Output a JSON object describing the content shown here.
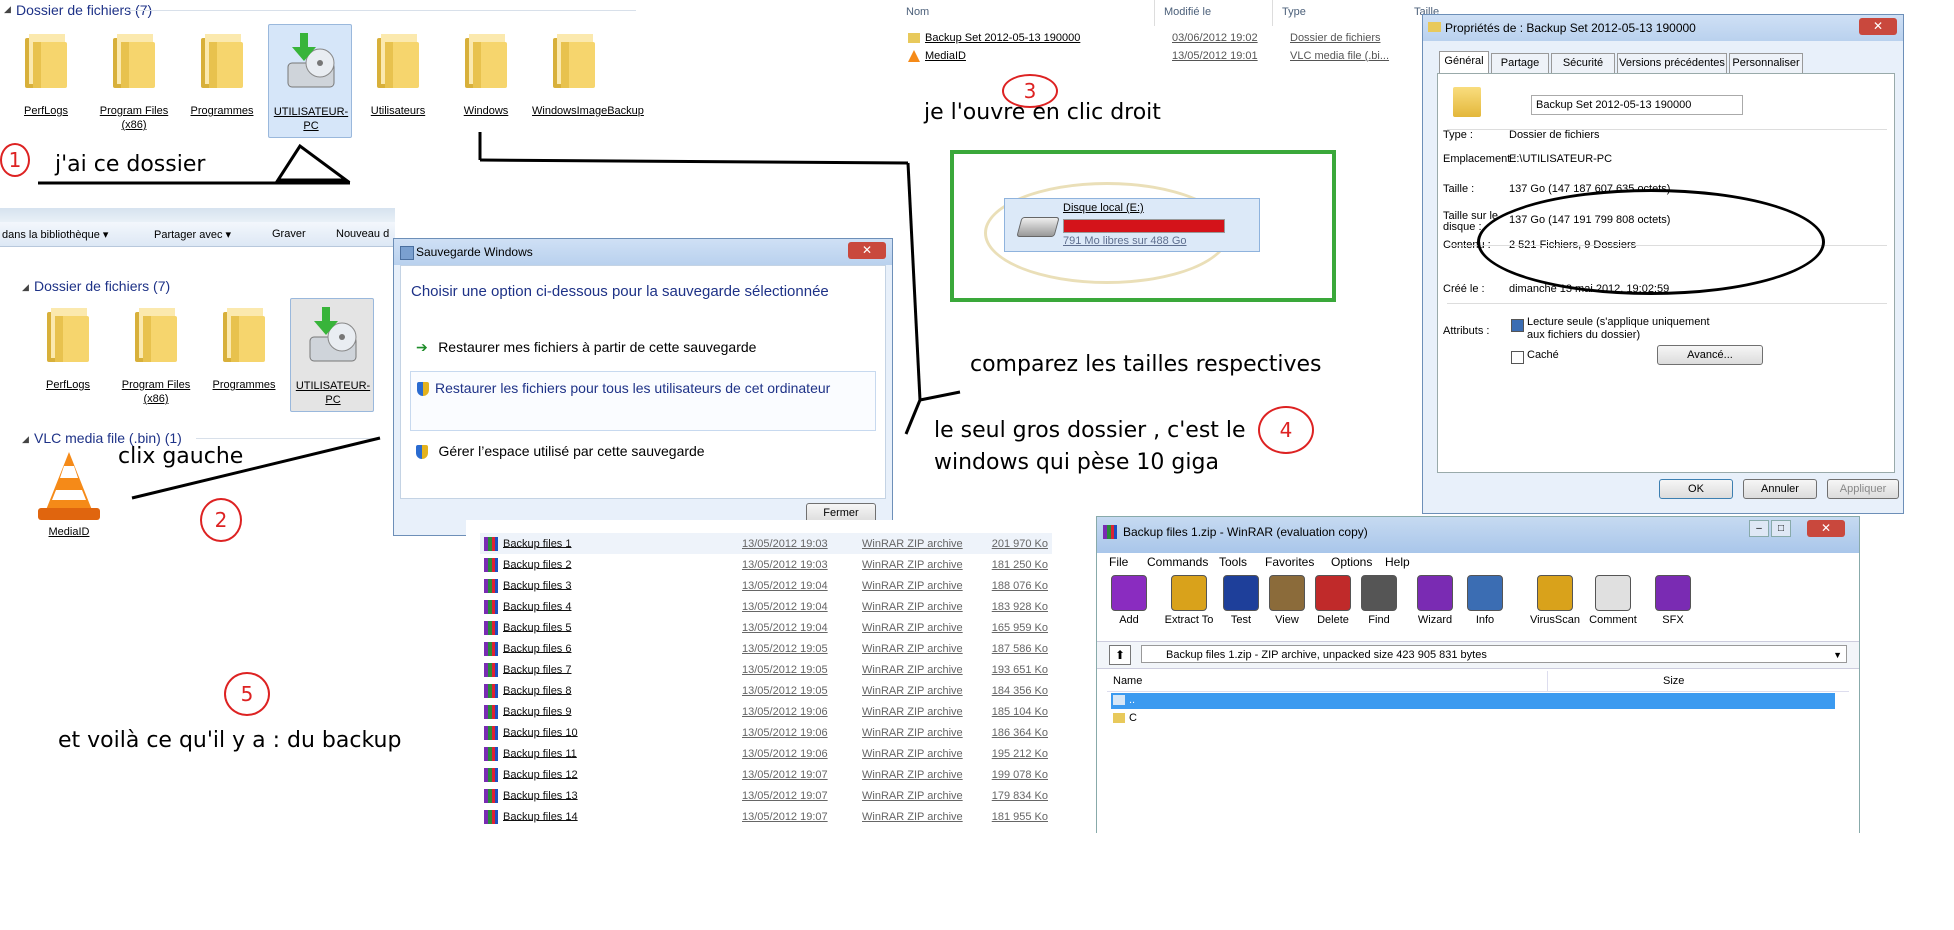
{
  "explorer1": {
    "header": "Dossier de fichiers (7)",
    "folders": [
      {
        "label": "PerfLogs"
      },
      {
        "label": "Program Files (x86)"
      },
      {
        "label": "Programmes"
      },
      {
        "label": "UTILISATEUR-PC"
      },
      {
        "label": "Utilisateurs"
      },
      {
        "label": "Windows"
      },
      {
        "label": "WindowsImageBackup"
      }
    ]
  },
  "annotations": {
    "a1": "j'ai ce dossier",
    "a2": "clix gauche",
    "a3": "je l'ouvre en clic droit",
    "a4a": "comparez les tailles respectives",
    "a4b": "le seul gros dossier , c'est le",
    "a4c": "windows qui pèse 10 giga",
    "a5": "et voilà ce qu'il y a : du backup",
    "n1": "1",
    "n2": "2",
    "n3": "3",
    "n4": "4",
    "n5": "5"
  },
  "explorer2": {
    "toolbar": [
      "dans la bibliothèque ▾",
      "Partager avec ▾",
      "Graver",
      "Nouveau d"
    ],
    "header": "Dossier de fichiers (7)",
    "folders": [
      {
        "label": "PerfLogs"
      },
      {
        "label": "Program Files (x86)"
      },
      {
        "label": "Programmes"
      },
      {
        "label": "UTILISATEUR-PC"
      }
    ],
    "vlc_header": "VLC media file (.bin) (1)",
    "vlc_label": "MediaID"
  },
  "sauvegarde": {
    "title": "Sauvegarde Windows",
    "prompt": "Choisir une option ci-dessous pour la sauvegarde sélectionnée",
    "opt1": "Restaurer mes fichiers à partir de cette sauvegarde",
    "opt2": "Restaurer les fichiers pour tous les utilisateurs de cet ordinateur",
    "opt3": "Gérer l’espace utilisé par cette sauvegarde",
    "close": "Fermer"
  },
  "detail_list": {
    "cols": [
      "Nom",
      "Modifié le",
      "Type",
      "Taille"
    ],
    "rows": [
      {
        "name": "Backup Set 2012-05-13 190000",
        "date": "03/06/2012 19:02",
        "type": "Dossier de fichiers"
      },
      {
        "name": "MediaID",
        "date": "13/05/2012 19:01",
        "type": "VLC media file (.bi..."
      }
    ]
  },
  "disk": {
    "name": "Disque local (E:)",
    "free": "791 Mo libres sur 488 Go",
    "fill_fraction": 0.998
  },
  "properties": {
    "title": "Propriétés de : Backup Set 2012-05-13 190000",
    "tabs": [
      "Général",
      "Partage",
      "Sécurité",
      "Versions précédentes",
      "Personnaliser"
    ],
    "name_value": "Backup Set 2012-05-13 190000",
    "rows": [
      {
        "label": "Type :",
        "value": "Dossier de fichiers"
      },
      {
        "label": "Emplacement :",
        "value": "E:\\UTILISATEUR-PC"
      },
      {
        "label": "Taille :",
        "value": "137 Go (147 187 607 635 octets)"
      },
      {
        "label": "Taille sur le disque :",
        "value": "137 Go (147 191 799 808 octets)"
      },
      {
        "label": "Contenu :",
        "value": "2 521 Fichiers, 9 Dossiers"
      },
      {
        "label": "Créé le :",
        "value": "dimanche 13 mai 2012, 19:02:59"
      }
    ],
    "attr_label": "Attributs :",
    "readonly": "Lecture seule (s'applique uniquement aux fichiers du dossier)",
    "hidden": "Caché",
    "advanced": "Avancé...",
    "ok": "OK",
    "cancel": "Annuler",
    "apply": "Appliquer"
  },
  "backup_files": [
    {
      "name": "Backup files 1",
      "date": "13/05/2012 19:03",
      "type": "WinRAR ZIP archive",
      "size": "201 970 Ko"
    },
    {
      "name": "Backup files 2",
      "date": "13/05/2012 19:03",
      "type": "WinRAR ZIP archive",
      "size": "181 250 Ko"
    },
    {
      "name": "Backup files 3",
      "date": "13/05/2012 19:04",
      "type": "WinRAR ZIP archive",
      "size": "188 076 Ko"
    },
    {
      "name": "Backup files 4",
      "date": "13/05/2012 19:04",
      "type": "WinRAR ZIP archive",
      "size": "183 928 Ko"
    },
    {
      "name": "Backup files 5",
      "date": "13/05/2012 19:04",
      "type": "WinRAR ZIP archive",
      "size": "165 959 Ko"
    },
    {
      "name": "Backup files 6",
      "date": "13/05/2012 19:05",
      "type": "WinRAR ZIP archive",
      "size": "187 586 Ko"
    },
    {
      "name": "Backup files 7",
      "date": "13/05/2012 19:05",
      "type": "WinRAR ZIP archive",
      "size": "193 651 Ko"
    },
    {
      "name": "Backup files 8",
      "date": "13/05/2012 19:05",
      "type": "WinRAR ZIP archive",
      "size": "184 356 Ko"
    },
    {
      "name": "Backup files 9",
      "date": "13/05/2012 19:06",
      "type": "WinRAR ZIP archive",
      "size": "185 104 Ko"
    },
    {
      "name": "Backup files 10",
      "date": "13/05/2012 19:06",
      "type": "WinRAR ZIP archive",
      "size": "186 364 Ko"
    },
    {
      "name": "Backup files 11",
      "date": "13/05/2012 19:06",
      "type": "WinRAR ZIP archive",
      "size": "195 212 Ko"
    },
    {
      "name": "Backup files 12",
      "date": "13/05/2012 19:07",
      "type": "WinRAR ZIP archive",
      "size": "199 078 Ko"
    },
    {
      "name": "Backup files 13",
      "date": "13/05/2012 19:07",
      "type": "WinRAR ZIP archive",
      "size": "179 834 Ko"
    },
    {
      "name": "Backup files 14",
      "date": "13/05/2012 19:07",
      "type": "WinRAR ZIP archive",
      "size": "181 955 Ko"
    }
  ],
  "winrar": {
    "title": "Backup files 1.zip - WinRAR (evaluation copy)",
    "menu": [
      "File",
      "Commands",
      "Tools",
      "Favorites",
      "Options",
      "Help"
    ],
    "tools": [
      "Add",
      "Extract To",
      "Test",
      "View",
      "Delete",
      "Find",
      "Wizard",
      "Info",
      "VirusScan",
      "Comment",
      "SFX"
    ],
    "path": "Backup files 1.zip - ZIP archive, unpacked size 423 905 831 bytes",
    "col_name": "Name",
    "col_size": "Size",
    "rows": [
      "..",
      "C"
    ]
  },
  "colors": {
    "accent": "#1e3287",
    "annotation_red": "#d22222",
    "green_box": "#3aa83a",
    "disk_bar": "#d4131a"
  }
}
